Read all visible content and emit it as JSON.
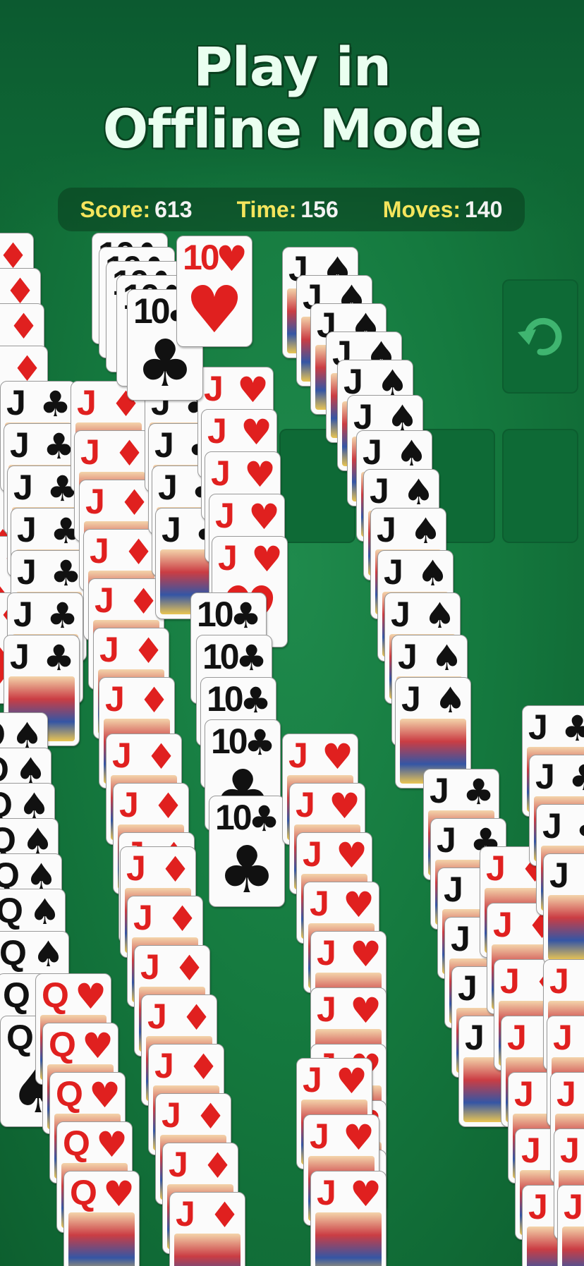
{
  "headline": {
    "line1": "Play in",
    "line2": "Offline Mode"
  },
  "stats": {
    "score_label": "Score:",
    "score_value": "613",
    "time_label": "Time:",
    "time_value": "156",
    "moves_label": "Moves:",
    "moves_value": "140"
  },
  "undo": {
    "icon": "undo-icon"
  },
  "colors": {
    "felt": "#157a3f",
    "slot": "#0e6a36",
    "label_yellow": "#f4e55c",
    "red_suit": "#e0201f"
  }
}
